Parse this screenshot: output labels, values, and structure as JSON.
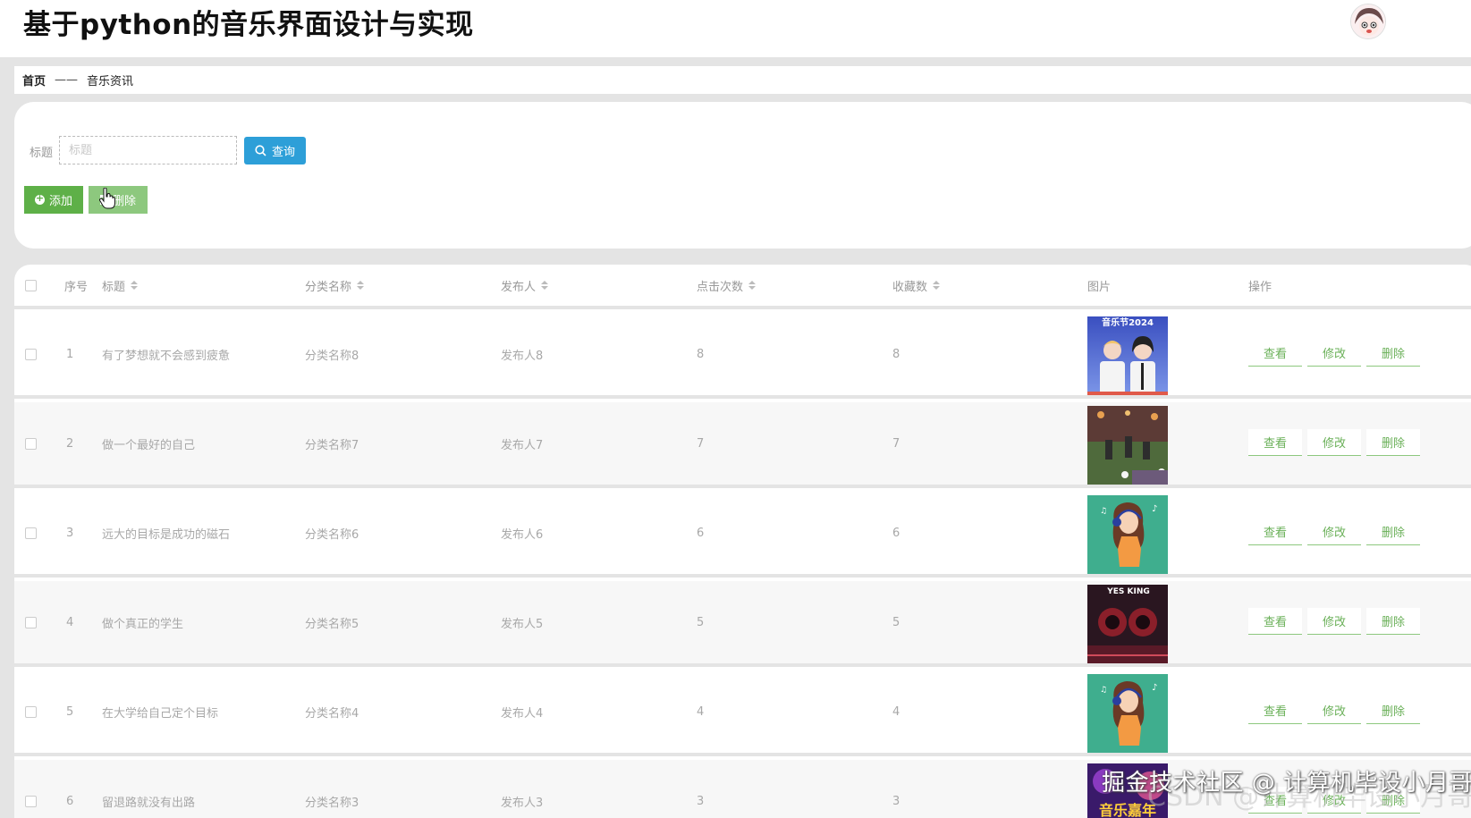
{
  "app": {
    "title": "基于python的音乐界面设计与实现"
  },
  "breadcrumb": {
    "home": "首页",
    "separator": "——",
    "current": "音乐资讯"
  },
  "search": {
    "label": "标题",
    "placeholder": "标题",
    "value": "",
    "button_label": "查询"
  },
  "actions": {
    "add_label": "添加",
    "delete_label": "删除"
  },
  "table": {
    "headers": {
      "index": "序号",
      "title": "标题",
      "category": "分类名称",
      "publisher": "发布人",
      "clicks": "点击次数",
      "favorites": "收藏数",
      "image": "图片",
      "operations": "操作"
    },
    "op_labels": {
      "view": "查看",
      "edit": "修改",
      "delete": "删除"
    },
    "rows": [
      {
        "index": "1",
        "title": "有了梦想就不会感到疲惫",
        "category": "分类名称8",
        "publisher": "发布人8",
        "clicks": "8",
        "favorites": "8",
        "image_caption": "音乐节2024",
        "image_theme": "festival-2024"
      },
      {
        "index": "2",
        "title": "做一个最好的自己",
        "category": "分类名称7",
        "publisher": "发布人7",
        "clicks": "7",
        "favorites": "7",
        "image_theme": "concert-stage"
      },
      {
        "index": "3",
        "title": "远大的目标是成功的磁石",
        "category": "分类名称6",
        "publisher": "发布人6",
        "clicks": "6",
        "favorites": "6",
        "image_theme": "girl-headphones"
      },
      {
        "index": "4",
        "title": "做个真正的学生",
        "category": "分类名称5",
        "publisher": "发布人5",
        "clicks": "5",
        "favorites": "5",
        "image_caption": "YES KING",
        "image_theme": "speakers"
      },
      {
        "index": "5",
        "title": "在大学给自己定个目标",
        "category": "分类名称4",
        "publisher": "发布人4",
        "clicks": "4",
        "favorites": "4",
        "image_theme": "girl-headphones"
      },
      {
        "index": "6",
        "title": "留退路就没有出路",
        "category": "分类名称3",
        "publisher": "发布人3",
        "clicks": "3",
        "favorites": "3",
        "image_caption": "音乐嘉年",
        "image_theme": "carnival"
      }
    ]
  },
  "watermark": {
    "text": "掘金技术社区 @ 计算机毕设小月哥",
    "ghost_text": "CSDN @计算机毕设小月哥"
  },
  "colors": {
    "primary_blue": "#2d9fd8",
    "add_green": "#5eb048",
    "delete_green": "#8dc87e",
    "link_green": "#6ab058"
  }
}
